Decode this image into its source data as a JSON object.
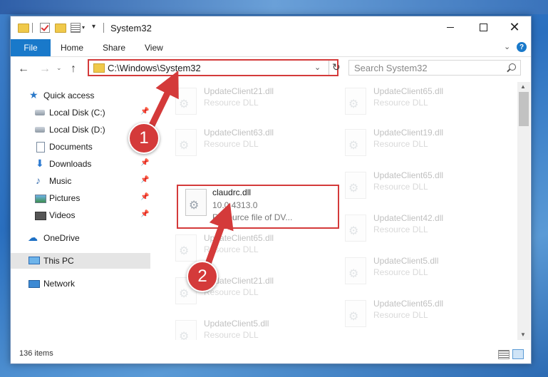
{
  "window": {
    "title": "System32"
  },
  "ribbon": {
    "file": "File",
    "home": "Home",
    "share": "Share",
    "view": "View"
  },
  "address": {
    "path": "C:\\Windows\\System32"
  },
  "search": {
    "placeholder": "Search System32"
  },
  "nav": {
    "items": [
      {
        "label": "Quick access"
      },
      {
        "label": "Local Disk (C:)"
      },
      {
        "label": "Local Disk (D:)"
      },
      {
        "label": "Documents"
      },
      {
        "label": "Downloads"
      },
      {
        "label": "Music"
      },
      {
        "label": "Pictures"
      },
      {
        "label": "Videos"
      },
      {
        "label": "OneDrive"
      },
      {
        "label": "This PC"
      },
      {
        "label": "Network"
      }
    ]
  },
  "files": {
    "highlighted": {
      "name": "claudrc.dll",
      "version": "10.0.4313.0",
      "desc": "Resource file of DV..."
    },
    "faded": [
      {
        "name": "UpdateClient21.dll",
        "desc": "Resource DLL"
      },
      {
        "name": "UpdateClient65.dll",
        "desc": "Resource DLL"
      },
      {
        "name": "UpdateClient63.dll",
        "desc": "Resource DLL"
      },
      {
        "name": "UpdateClient19.dll",
        "desc": "Resource DLL"
      },
      {
        "name": "UpdateClient65.dll",
        "desc": "Resource DLL"
      },
      {
        "name": "UpdateClient65.dll",
        "desc": "Resource DLL"
      },
      {
        "name": "UpdateClient42.dll",
        "desc": "Resource DLL"
      },
      {
        "name": "UpdateClient21.dll",
        "desc": "Resource DLL"
      },
      {
        "name": "UpdateClient5.dll",
        "desc": "Resource DLL"
      },
      {
        "name": "UpdateClient5.dll",
        "desc": "Resource DLL"
      },
      {
        "name": "UpdateClient65.dll",
        "desc": "Resource DLL"
      }
    ]
  },
  "status": {
    "count": "136 items"
  },
  "callouts": {
    "one": "1",
    "two": "2"
  }
}
